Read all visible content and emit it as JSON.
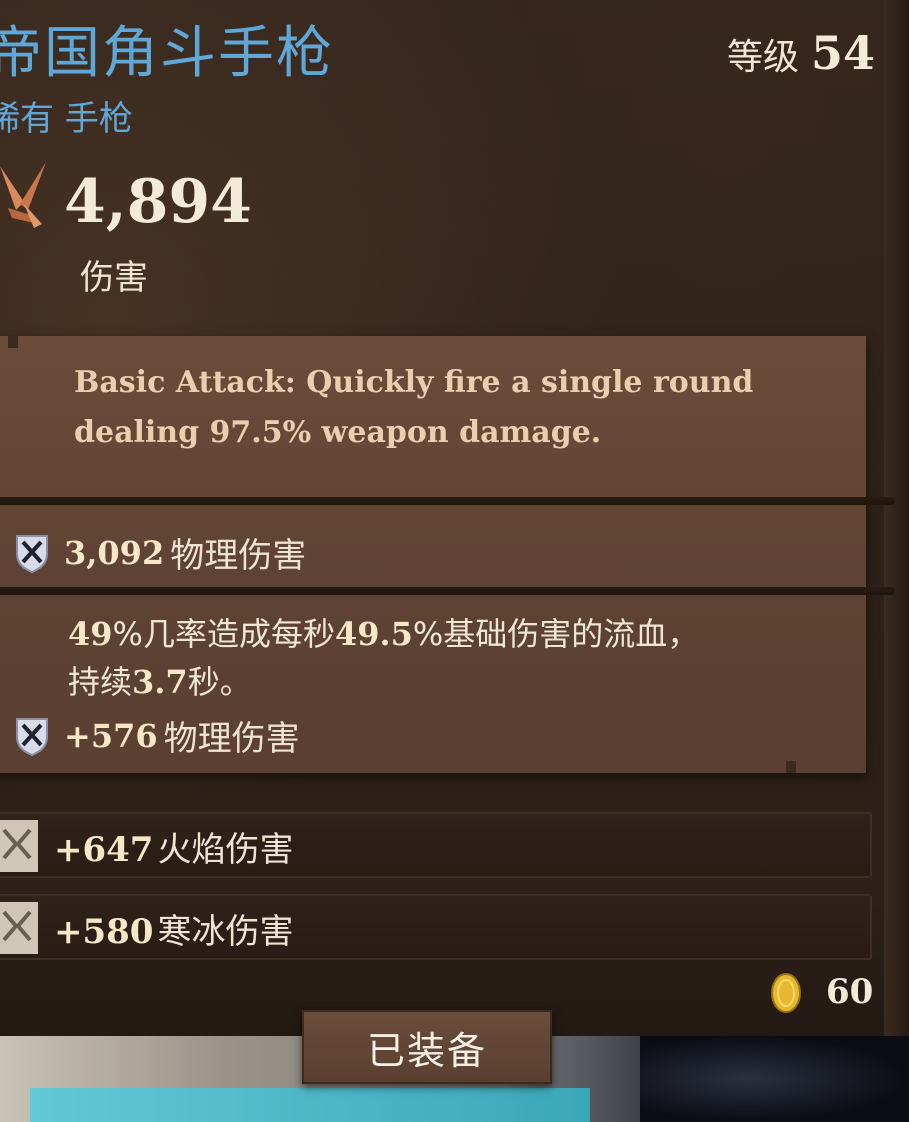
{
  "item": {
    "name": "帝国角斗手枪",
    "rarity_type": "稀有 手枪",
    "level_label": "等级",
    "level_value": "54",
    "damage_value": "4,894",
    "damage_label": "伤害"
  },
  "ability": {
    "description": "Basic Attack: Quickly fire a single round dealing 97.5% weapon damage."
  },
  "stats": {
    "base_damage_value": "3,092",
    "base_damage_label": "物理伤害",
    "bleed_chance": "49",
    "bleed_mid": "%几率造成每秒",
    "bleed_pct": "49.5",
    "bleed_end": "%基础伤害的流血，",
    "bleed_dur_prefix": "持续",
    "bleed_duration": "3.7",
    "bleed_dur_suffix": "秒。",
    "bonus_phys_value": "+576",
    "bonus_phys_label": "物理伤害"
  },
  "perks": [
    {
      "value": "+647",
      "label": "火焰伤害",
      "icon": "rune-icon"
    },
    {
      "value": "+580",
      "label": "寒冰伤害",
      "icon": "rune-icon"
    }
  ],
  "gold": {
    "value": "60",
    "icon": "gold-coin-icon"
  },
  "equip_button": {
    "label": "已装备"
  },
  "colors": {
    "rarity_blue": "#5fa7d6",
    "panel": "#5e4233",
    "gold": "#e8b830"
  }
}
